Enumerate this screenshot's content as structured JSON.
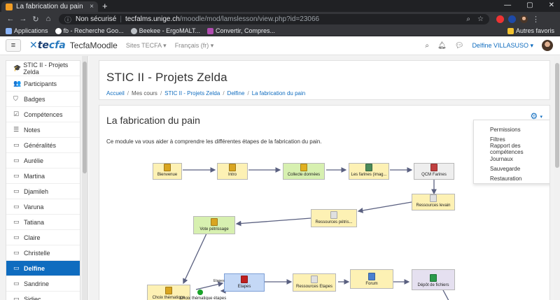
{
  "browser": {
    "tab_title": "La fabrication du pain",
    "tab_close": "×",
    "new_tab": "+",
    "window_controls": [
      "—",
      "▢",
      "✕"
    ],
    "security_label": "Non sécurisé",
    "url_host": "tecfalms.unige.ch",
    "url_path": "/moodle/mod/lamslesson/view.php?id=23066",
    "bookmarks": [
      {
        "label": "Applications",
        "color": "#8ab4f8"
      },
      {
        "label": "fb - Recherche Goo...",
        "color": "#ffffff"
      },
      {
        "label": "Beekee - ErgoMALT...",
        "color": "#bdc1c6"
      },
      {
        "label": "Convertir, Compres...",
        "color": "#b04cb0"
      }
    ],
    "bookmarks_right": "Autres favoris"
  },
  "navbar": {
    "logo_part1": "te",
    "logo_part2": "cfa",
    "site_name": "TecfaMoodle",
    "menu": [
      "Sites TECFA ▾",
      "Français (fr) ▾"
    ],
    "user_name": "Delfine VILLASUSO ▾"
  },
  "drawer": {
    "items": [
      {
        "label": "STIC II - Projets Zelda",
        "icon": "🎓",
        "active": false
      },
      {
        "label": "Participants",
        "icon": "👥",
        "active": false
      },
      {
        "label": "Badges",
        "icon": "⛉",
        "active": false
      },
      {
        "label": "Compétences",
        "icon": "☑",
        "active": false
      },
      {
        "label": "Notes",
        "icon": "☰",
        "active": false
      },
      {
        "label": "Généralités",
        "icon": "▭",
        "active": false
      },
      {
        "label": "Aurélie",
        "icon": "▭",
        "active": false
      },
      {
        "label": "Martina",
        "icon": "▭",
        "active": false
      },
      {
        "label": "Djamileh",
        "icon": "▭",
        "active": false
      },
      {
        "label": "Varuna",
        "icon": "▭",
        "active": false
      },
      {
        "label": "Tatiana",
        "icon": "▭",
        "active": false
      },
      {
        "label": "Claire",
        "icon": "▭",
        "active": false
      },
      {
        "label": "Christelle",
        "icon": "▭",
        "active": false
      },
      {
        "label": "Delfine",
        "icon": "▭",
        "active": true
      },
      {
        "label": "Sandrine",
        "icon": "▭",
        "active": false
      },
      {
        "label": "Sidiec",
        "icon": "▭",
        "active": false
      }
    ]
  },
  "header": {
    "title": "STIC II - Projets Zelda",
    "breadcrumb": [
      {
        "label": "Accueil",
        "link": true
      },
      {
        "label": "Mes cours",
        "link": false
      },
      {
        "label": "STIC II - Projets Zelda",
        "link": true
      },
      {
        "label": "Delfine",
        "link": true
      },
      {
        "label": "La fabrication du pain",
        "link": true
      }
    ]
  },
  "activity": {
    "title": "La fabrication du pain",
    "description": "Ce module va vous aider à comprendre les différentes étapes de la fabrication du pain.",
    "gear_icon": "⚙",
    "settings_menu": [
      "Permissions",
      "Filtres",
      "Rapport des compétences",
      "Journaux",
      "Sauvegarde",
      "Restauration"
    ]
  },
  "sequence": {
    "nodes": [
      {
        "label": "Bienvenue",
        "style": "y",
        "icon_color": "#d9a520"
      },
      {
        "label": "Intro",
        "style": "y",
        "icon_color": "#d9a520"
      },
      {
        "label": "Collecte données",
        "style": "g",
        "icon_color": "#e0b020"
      },
      {
        "label": "Les farines (imag...",
        "style": "y",
        "icon_color": "#4a8a5a"
      },
      {
        "label": "QCM Farines",
        "style": "gray",
        "icon_color": "#c04040"
      },
      {
        "label": "Ressources levain",
        "style": "y",
        "icon_color": "#e0e0e0"
      },
      {
        "label": "Ressources pétris...",
        "style": "y",
        "icon_color": "#e0e0e0"
      },
      {
        "label": "Vote pétrissage",
        "style": "g",
        "icon_color": "#d9a520"
      },
      {
        "label": "Choix thématique",
        "style": "y",
        "icon_color": "#d9a520"
      },
      {
        "label": "Choix thématique étapes",
        "style": "y",
        "icon_color": "#20a040"
      },
      {
        "label": "Etapes",
        "style": "b",
        "icon_color": "#c02020"
      },
      {
        "label": "Ressources Etapes",
        "style": "y",
        "icon_color": "#e0e0e0"
      },
      {
        "label": "Forum",
        "style": "y",
        "icon_color": "#4a80d0"
      },
      {
        "label": "Dépôt de fichiers",
        "style": "p",
        "icon_color": "#2a9a4a"
      }
    ],
    "edge_label": "Etapes"
  }
}
